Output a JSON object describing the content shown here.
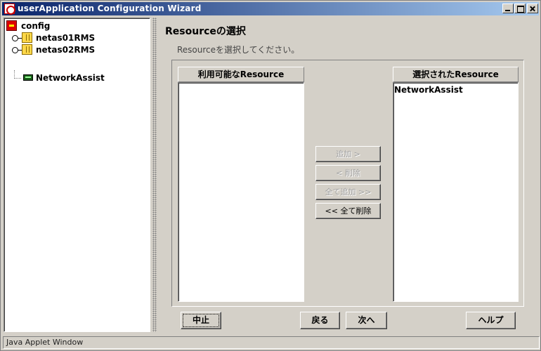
{
  "window": {
    "title": "userApplication Configuration Wizard"
  },
  "tree": {
    "root": {
      "label": "config",
      "icon": "config-icon"
    },
    "nodes": [
      {
        "label": "netas01RMS",
        "icon": "server-icon"
      },
      {
        "label": "netas02RMS",
        "icon": "server-icon"
      },
      {
        "label": "NetworkAssist",
        "icon": "network-card-icon"
      }
    ]
  },
  "main": {
    "heading": "Resourceの選択",
    "subtitle": "Resourceを選択してください。",
    "available_header": "利用可能なResource",
    "selected_header": "選択されたResource",
    "available_items": [],
    "selected_items": [
      "NetworkAssist"
    ],
    "move_buttons": {
      "add": "追加 >",
      "remove": "< 削除",
      "add_all": "全て追加 >>",
      "remove_all": "<< 全て削除"
    }
  },
  "footer": {
    "cancel": "中止",
    "back": "戻る",
    "next": "次へ",
    "help": "ヘルプ"
  },
  "status": {
    "text": "Java Applet Window"
  }
}
